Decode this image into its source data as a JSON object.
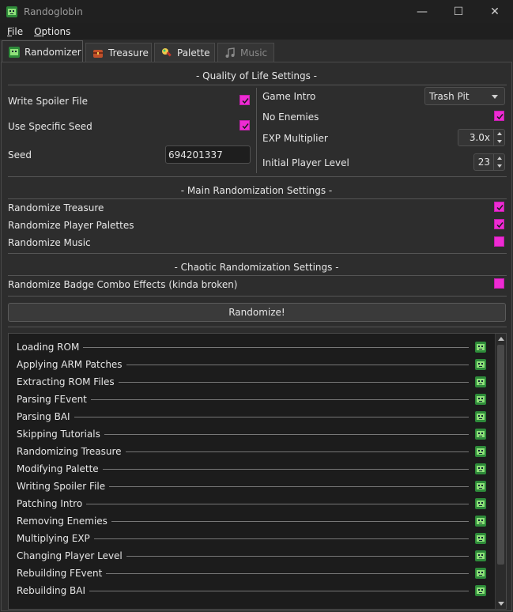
{
  "window": {
    "title": "Randoglobin",
    "controls": [
      "—",
      "☐",
      "✕"
    ]
  },
  "menu": {
    "file_label": "File",
    "file_mn": "F",
    "file_rest": "ile",
    "options_mn": "O",
    "options_rest": "ptions"
  },
  "tabs": [
    {
      "label": "Randomizer",
      "icon": "goblin-icon",
      "active": true
    },
    {
      "label": "Treasure",
      "icon": "treasure-chest-icon"
    },
    {
      "label": "Palette",
      "icon": "paint-brush-icon"
    },
    {
      "label": "Music",
      "icon": "music-note-icon",
      "disabled": true
    }
  ],
  "qol": {
    "title": "- Quality of Life Settings -",
    "write_spoiler": {
      "label": "Write Spoiler File",
      "checked": true
    },
    "use_seed": {
      "label": "Use Specific Seed",
      "checked": true
    },
    "seed": {
      "label": "Seed",
      "value": "694201337"
    },
    "game_intro": {
      "label": "Game Intro",
      "value": "Trash Pit"
    },
    "no_enemies": {
      "label": "No Enemies",
      "checked": true
    },
    "exp_mult": {
      "label": "EXP Multiplier",
      "value": "3.0x"
    },
    "init_level": {
      "label": "Initial Player Level",
      "value": "23"
    }
  },
  "main": {
    "title": "- Main Randomization Settings -",
    "treasure": {
      "label": "Randomize Treasure",
      "checked": true
    },
    "palettes": {
      "label": "Randomize Player Palettes",
      "checked": true
    },
    "music": {
      "label": "Randomize Music",
      "checked": false
    }
  },
  "chaotic": {
    "title": "- Chaotic Randomization Settings -",
    "badge": {
      "label": "Randomize Badge Combo Effects  (kinda broken)",
      "checked": false
    }
  },
  "randomize_button": "Randomize!",
  "log": [
    "Loading ROM",
    "Applying ARM Patches",
    "Extracting ROM Files",
    "Parsing FEvent",
    "Parsing BAI",
    "Skipping Tutorials",
    "Randomizing Treasure",
    "Modifying Palette",
    "Writing Spoiler File",
    "Patching Intro",
    "Removing Enemies",
    "Multiplying EXP",
    "Changing Player Level",
    "Rebuilding FEvent",
    "Rebuilding BAI"
  ],
  "colors": {
    "accent": "#ee2bd3",
    "bg": "#2d2d2d",
    "log_bg": "#1c1c1c"
  }
}
